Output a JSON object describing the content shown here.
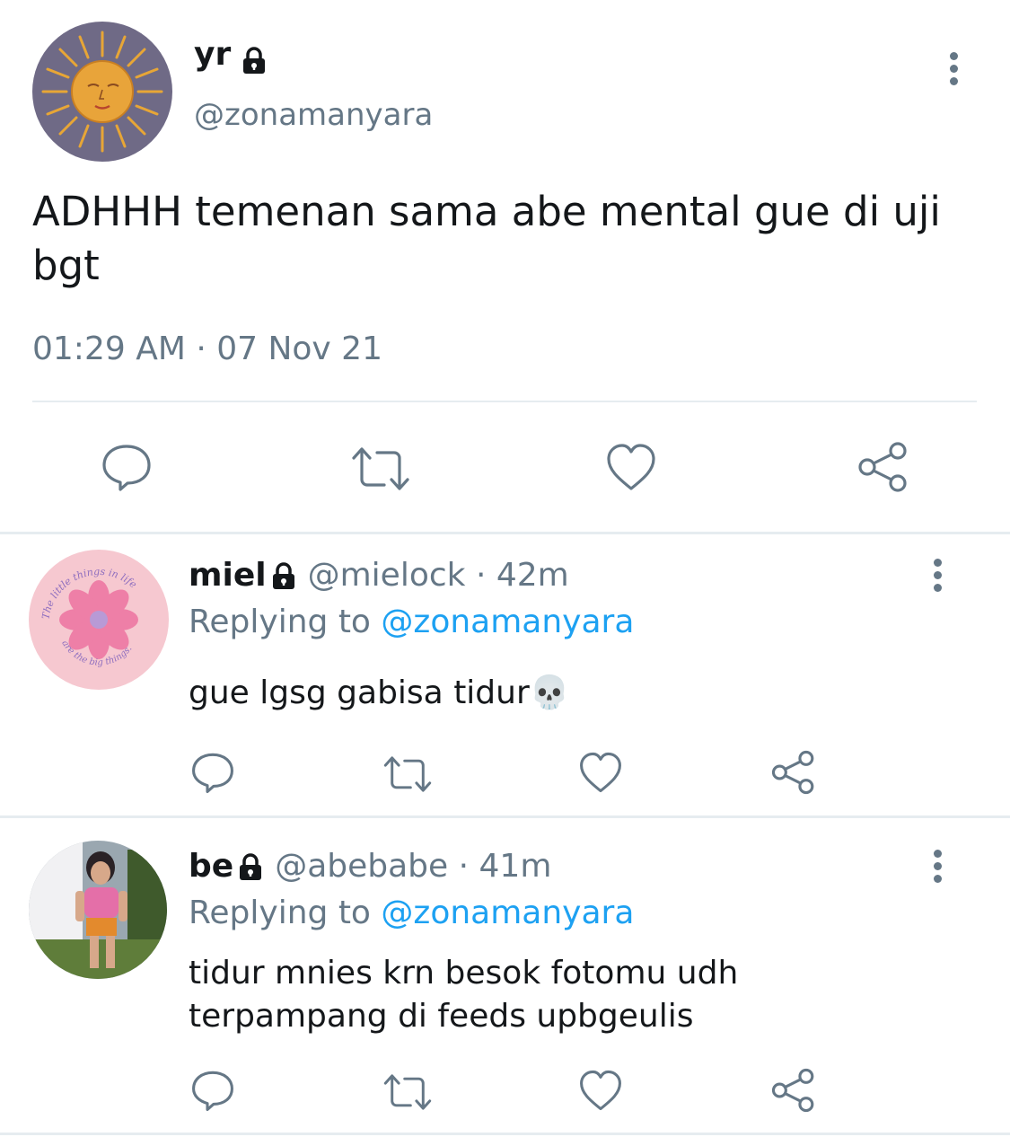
{
  "main_tweet": {
    "display_name": "yr",
    "handle": "@zonamanyara",
    "text": "ADHHH temenan sama abe mental gue di uji bgt",
    "timestamp": "01:29 AM · 07 Nov 21",
    "protected_icon": "lock-icon",
    "actions": [
      "reply-icon",
      "retweet-icon",
      "like-icon",
      "share-icon"
    ]
  },
  "replies": [
    {
      "display_name": "miel",
      "handle": "@mielock",
      "time": "· 42m",
      "replying_label": "Replying to",
      "replying_to": "@zonamanyara",
      "text": "gue lgsg gabisa tidur💀",
      "avatar_text_top": "The little things in life",
      "avatar_text_bottom": "are the big things."
    },
    {
      "display_name": "be",
      "handle": "@abebabe",
      "time": "· 41m",
      "replying_label": "Replying to",
      "replying_to": "@zonamanyara",
      "text_line1": "tidur mnies krn besok fotomu udh",
      "text_line2": "terpampang di feeds upbgeulis"
    }
  ],
  "colors": {
    "accent": "#1da1f2",
    "muted": "#657786",
    "divider": "#e6ecf0",
    "text": "#14171a"
  }
}
